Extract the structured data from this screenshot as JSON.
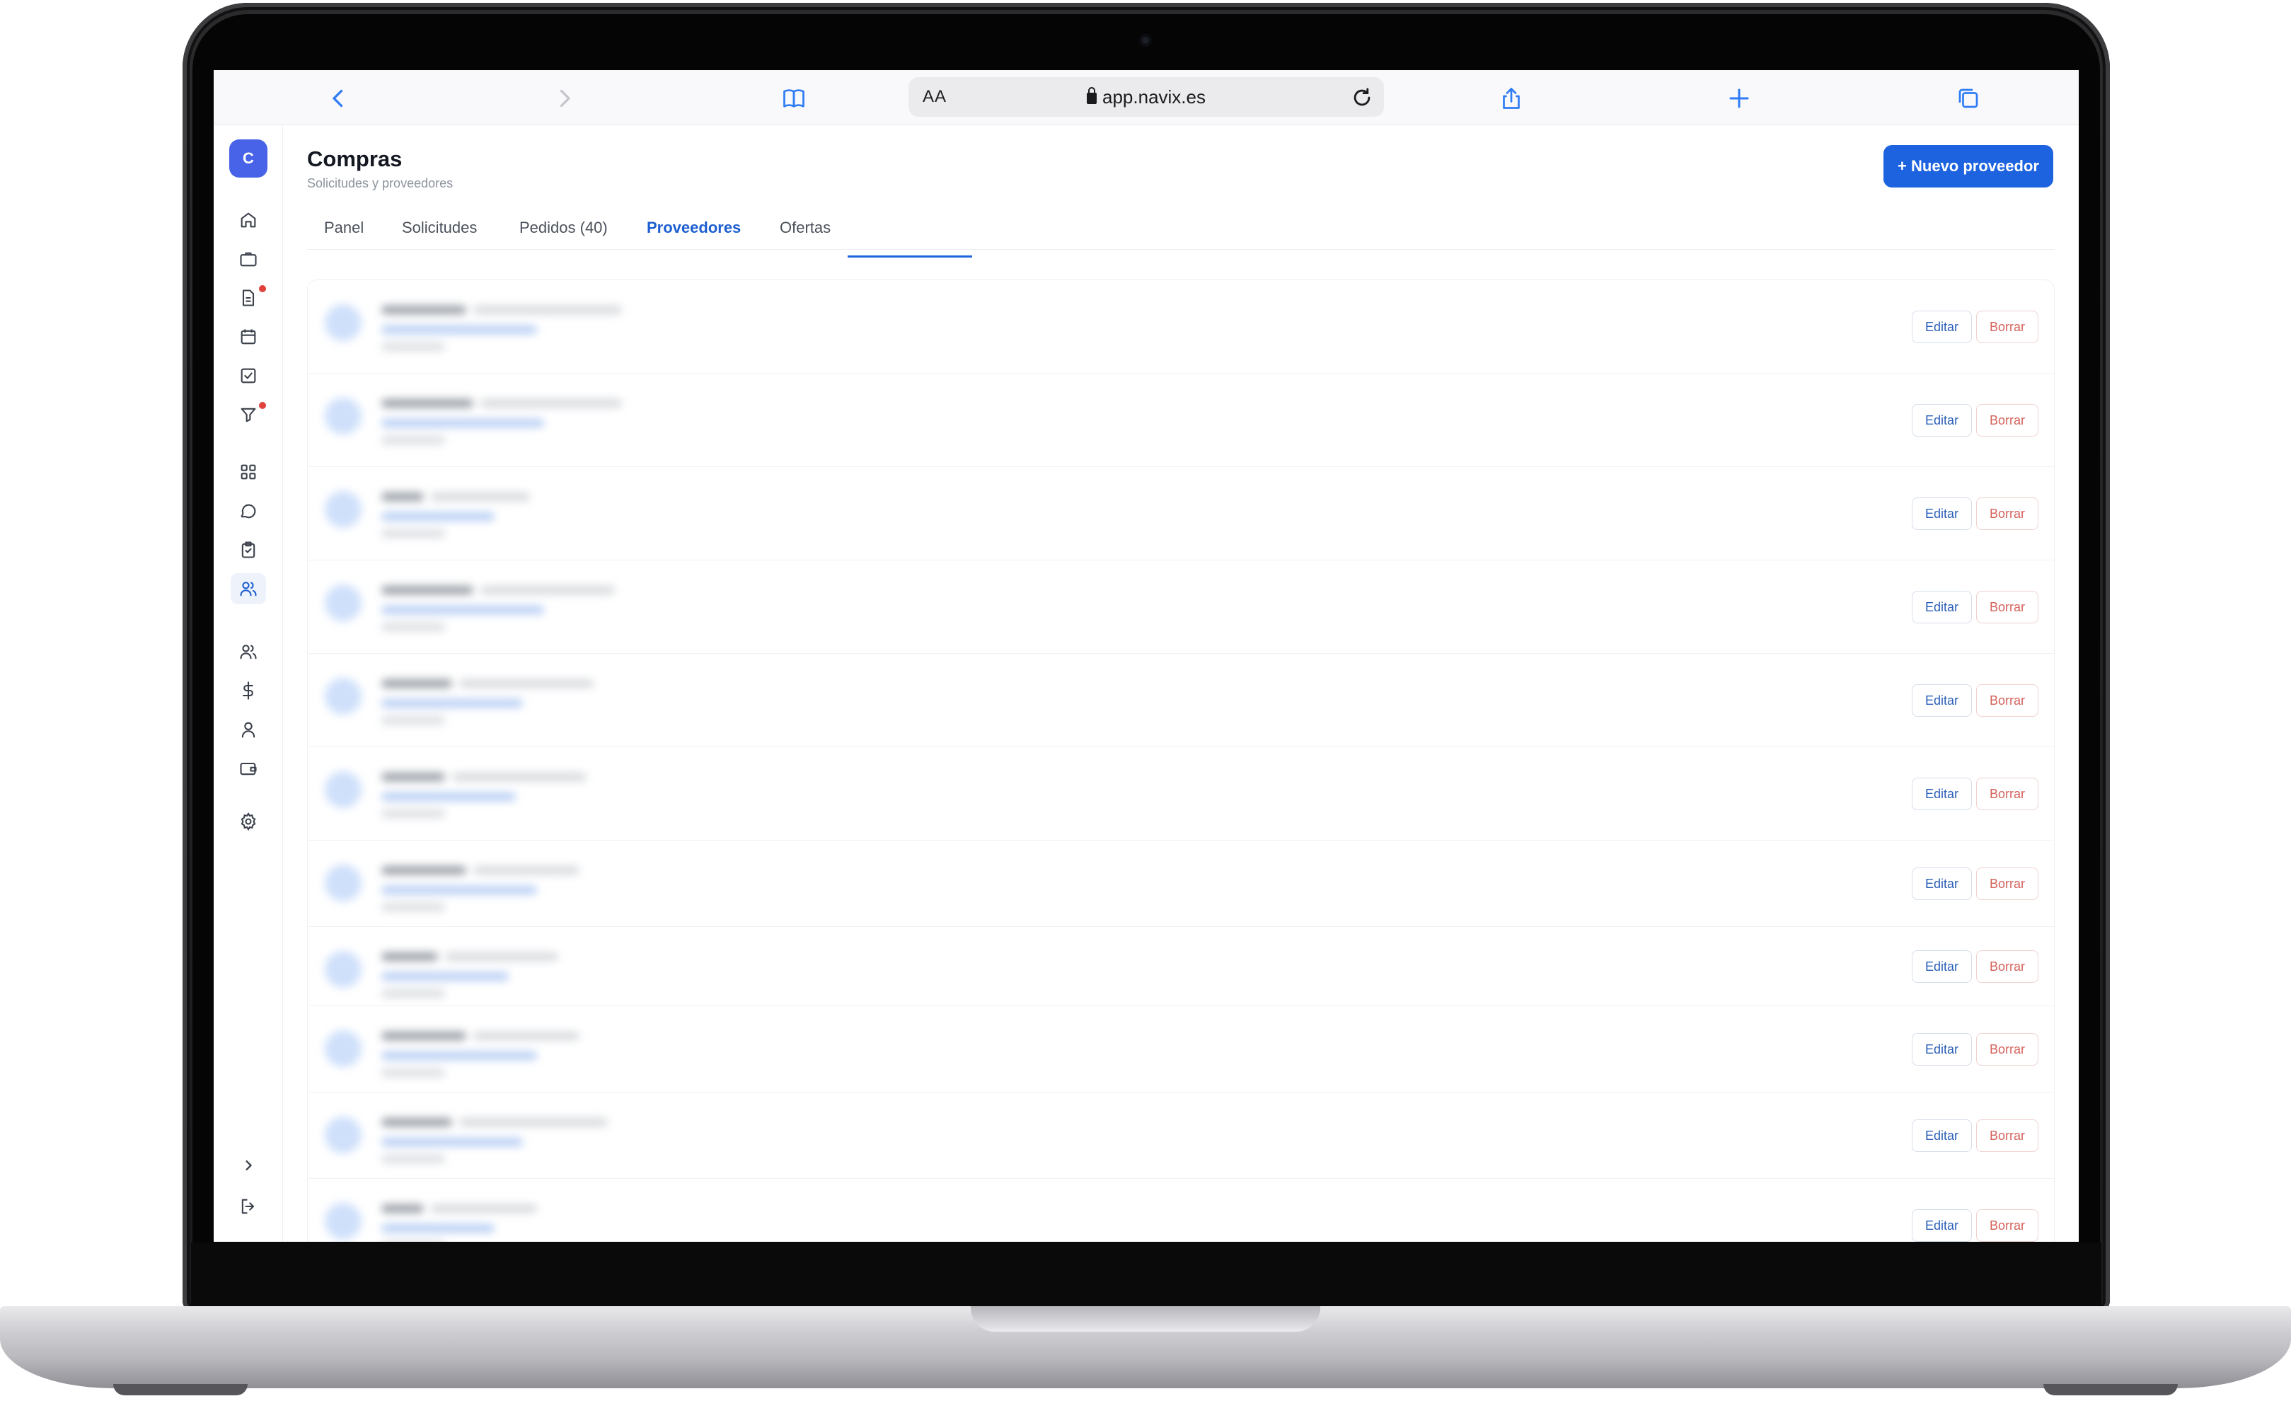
{
  "browser": {
    "url": "app.navix.es",
    "reader_label": "AA"
  },
  "app": {
    "avatar_initial": "C",
    "title": "Compras",
    "subtitle": "Solicitudes y proveedores",
    "new_button_label": "+ Nuevo proveedor",
    "accent_color": "#1d63e0"
  },
  "sidebar": {
    "items": [
      {
        "icon": "home-icon"
      },
      {
        "icon": "briefcase-icon"
      },
      {
        "icon": "document-icon",
        "badge": true
      },
      {
        "icon": "calendar-icon"
      },
      {
        "icon": "checkbox-icon"
      },
      {
        "icon": "filter-icon",
        "badge": true
      },
      {
        "icon": "grid-icon"
      },
      {
        "icon": "chat-icon"
      },
      {
        "icon": "clipboard-icon"
      },
      {
        "icon": "users-icon",
        "active": true
      },
      {
        "icon": "team-icon"
      },
      {
        "icon": "dollar-icon"
      },
      {
        "icon": "user-icon"
      },
      {
        "icon": "wallet-icon"
      },
      {
        "icon": "gear-icon"
      },
      {
        "icon": "chevron-right-icon"
      },
      {
        "icon": "logout-icon"
      }
    ]
  },
  "tabs": [
    {
      "label": "Panel",
      "active": false
    },
    {
      "label": "Solicitudes",
      "active": false
    },
    {
      "label": "Pedidos (40)",
      "active": false
    },
    {
      "label": "Proveedores",
      "active": true
    },
    {
      "label": "Ofertas",
      "active": false
    }
  ],
  "suppliers": {
    "edit_label": "Editar",
    "delete_label": "Borrar",
    "rows": [
      {},
      {},
      {},
      {},
      {},
      {},
      {},
      {},
      {},
      {},
      {}
    ]
  }
}
